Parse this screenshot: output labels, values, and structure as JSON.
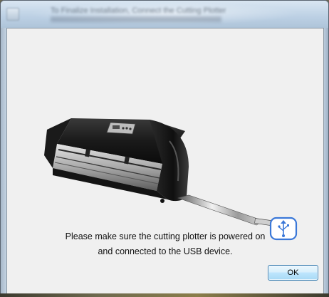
{
  "window": {
    "title": "To Finalize Installation, Connect the Cutting Plotter"
  },
  "dialog": {
    "message_line1": "Please make sure the cutting plotter is powered on",
    "message_line2": "and connected to the USB device.",
    "ok_label": "OK"
  },
  "illustration": {
    "device": "cutting-plotter",
    "connector_icon": "usb-icon"
  },
  "colors": {
    "titlebar": "#bcd0e4",
    "dialog_background": "#f0f0f0",
    "usb_icon": "#3b78d8",
    "ok_button_border": "#3c7fb1"
  }
}
